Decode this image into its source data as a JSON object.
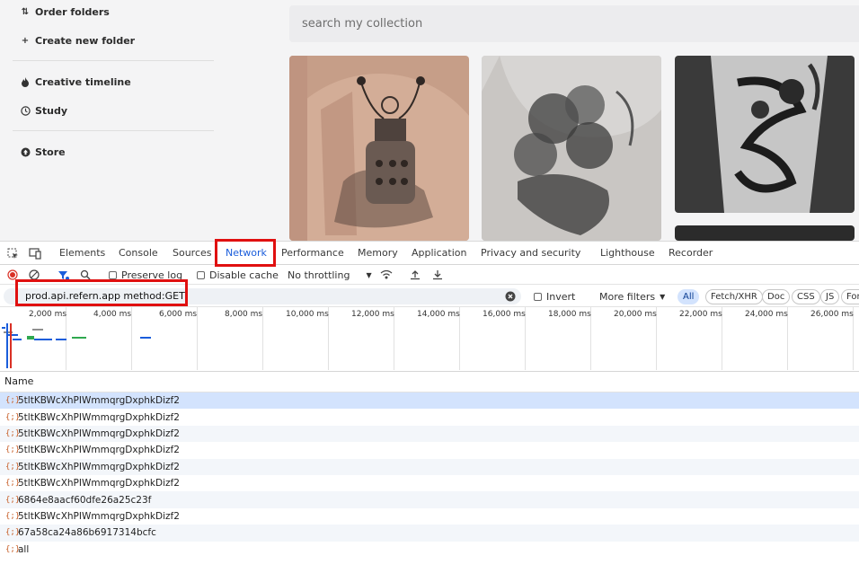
{
  "sidebar": {
    "items": [
      {
        "label": "Order folders",
        "icon": "sort-icon"
      },
      {
        "label": "Create new folder",
        "icon": "plus-icon"
      },
      {
        "label": "Creative timeline",
        "icon": "fire-icon"
      },
      {
        "label": "Study",
        "icon": "clock-icon"
      },
      {
        "label": "Store",
        "icon": "arrow-up-circle-icon"
      }
    ]
  },
  "search": {
    "placeholder": "search my collection"
  },
  "devtools": {
    "tabs": [
      "Elements",
      "Console",
      "Sources",
      "Network",
      "Performance",
      "Memory",
      "Application",
      "Privacy and security",
      "Lighthouse",
      "Recorder"
    ],
    "active_tab": "Network",
    "toolbar": {
      "preserve_log": "Preserve log",
      "disable_cache": "Disable cache",
      "throttling": "No throttling"
    },
    "filter": {
      "value": "prod.api.refern.app method:GET",
      "invert": "Invert",
      "more_filters": "More filters",
      "chips": [
        "All",
        "Fetch/XHR",
        "Doc",
        "CSS",
        "JS",
        "Fon"
      ]
    },
    "timeline_ticks": [
      "2,000 ms",
      "4,000 ms",
      "6,000 ms",
      "8,000 ms",
      "10,000 ms",
      "12,000 ms",
      "14,000 ms",
      "16,000 ms",
      "18,000 ms",
      "20,000 ms",
      "22,000 ms",
      "24,000 ms",
      "26,000 ms"
    ],
    "name_header": "Name",
    "requests": [
      "5tltKBWcXhPIWmmqrgDxphkDizf2",
      "5tltKBWcXhPIWmmqrgDxphkDizf2",
      "5tltKBWcXhPIWmmqrgDxphkDizf2",
      "5tltKBWcXhPIWmmqrgDxphkDizf2",
      "5tltKBWcXhPIWmmqrgDxphkDizf2",
      "5tltKBWcXhPIWmmqrgDxphkDizf2",
      "6864e8aacf60dfe26a25c23f",
      "5tltKBWcXhPIWmmqrgDxphkDizf2",
      "67a58ca24a86b6917314bcfc",
      "all"
    ]
  },
  "colors": {
    "accent": "#1a5ddb",
    "highlight": "#e01010",
    "selected_row": "#d3e3fd"
  }
}
